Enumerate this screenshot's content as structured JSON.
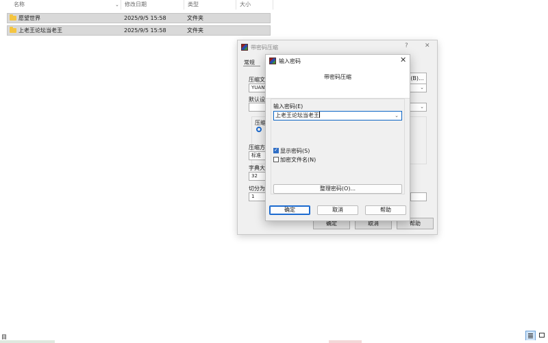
{
  "explorer": {
    "columns": {
      "name": "名称",
      "modified": "修改日期",
      "type": "类型",
      "size": "大小"
    },
    "rows": [
      {
        "name": "愿望世界",
        "modified": "2025/9/5 15:58",
        "type": "文件夹"
      },
      {
        "name": "上老王论坛当老王",
        "modified": "2025/9/5 15:58",
        "type": "文件夹"
      }
    ],
    "status": "目"
  },
  "back_dialog": {
    "title": "带密码压缩",
    "help_glyph": "?",
    "close_glyph": "✕",
    "tab_general": "常规",
    "archive_label": "压缩文",
    "archive_value": "YUANW",
    "browse_label": "(B)...",
    "profile_label": "默认设",
    "format_label": "压缩",
    "method_label": "压缩方",
    "method_value": "标准",
    "dict_label": "字典大",
    "dict_value": "32",
    "split_label": "切分为",
    "split_value": "1",
    "ok": "确定",
    "cancel": "取消",
    "help": "帮助"
  },
  "password_dialog": {
    "title": "输入密码",
    "header": "带密码压缩",
    "enter_label": "输入密码(E)",
    "password_value": "上老王论坛当老王",
    "show_password": {
      "label": "显示密码(S)",
      "checked": true
    },
    "encrypt_names": {
      "label": "加密文件名(N)",
      "checked": false
    },
    "organize": "整理密码(O)...",
    "ok": "确定",
    "cancel": "取消",
    "help": "帮助"
  },
  "icons": [
    "folder-icon",
    "winrar-icon",
    "chevron-down-icon",
    "close-icon",
    "help-icon",
    "details-view-icon",
    "tiles-view-icon"
  ],
  "colors": {
    "accent": "#1b6acf",
    "folder": "#f4c542",
    "row_selected": "#d9d9d9"
  }
}
